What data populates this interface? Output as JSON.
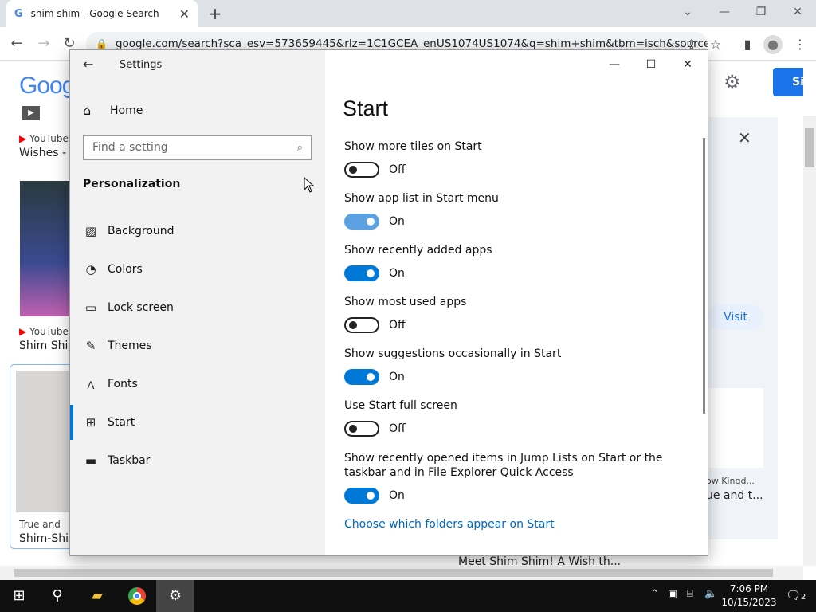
{
  "browser": {
    "tab_title": "shim shim - Google Search",
    "url": "google.com/search?sca_esv=573659445&rlz=1C1GCEA_enUS1074US1074&q=shim+shim&tbm=isch&source=l..."
  },
  "google": {
    "logo": "Goog",
    "signin": "Si",
    "results": [
      {
        "source": "YouTube",
        "title": "Wishes - M"
      },
      {
        "source": "YouTube",
        "title": "Shim Shim"
      },
      {
        "source": "True and",
        "title": "Shim-Shim"
      }
    ],
    "right_caption_source": "ow Kingd...",
    "right_caption_title": "ue and t...",
    "bottom_caption": "Meet Shim Shim! A Wish th...",
    "visit": "Visit"
  },
  "settings": {
    "window_title": "Settings",
    "home": "Home",
    "search_placeholder": "Find a setting",
    "section": "Personalization",
    "nav": [
      {
        "label": "Background",
        "icon": "image-icon"
      },
      {
        "label": "Colors",
        "icon": "palette-icon"
      },
      {
        "label": "Lock screen",
        "icon": "lock-screen-icon"
      },
      {
        "label": "Themes",
        "icon": "themes-icon"
      },
      {
        "label": "Fonts",
        "icon": "fonts-icon"
      },
      {
        "label": "Start",
        "icon": "start-icon",
        "active": true
      },
      {
        "label": "Taskbar",
        "icon": "taskbar-icon"
      }
    ],
    "page_title": "Start",
    "options": [
      {
        "label": "Show more tiles on Start",
        "state": "Off"
      },
      {
        "label": "Show app list in Start menu",
        "state": "On"
      },
      {
        "label": "Show recently added apps",
        "state": "On"
      },
      {
        "label": "Show most used apps",
        "state": "Off"
      },
      {
        "label": "Show suggestions occasionally in Start",
        "state": "On"
      },
      {
        "label": "Use Start full screen",
        "state": "Off"
      },
      {
        "label": "Show recently opened items in Jump Lists on Start or the taskbar and in File Explorer Quick Access",
        "state": "On"
      }
    ],
    "link": "Choose which folders appear on Start"
  },
  "taskbar": {
    "time": "7:06 PM",
    "date": "10/15/2023",
    "notifications": "2"
  }
}
